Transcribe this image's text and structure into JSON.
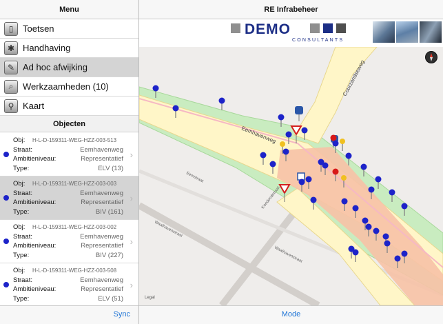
{
  "sidebar": {
    "title": "Menu",
    "menu": [
      {
        "label": "Toetsen",
        "icon": "document-icon"
      },
      {
        "label": "Handhaving",
        "icon": "sparkle-icon"
      },
      {
        "label": "Ad hoc afwijking",
        "icon": "pencil-icon",
        "selected": true
      },
      {
        "label": "Werkzaamheden (10)",
        "icon": "magnifier-icon"
      },
      {
        "label": "Kaart",
        "icon": "map-pin-icon"
      }
    ],
    "section_title": "Objecten",
    "field_labels": {
      "obj": "Obj:",
      "straat": "Straat:",
      "ambitie": "Ambitieniveau:",
      "type": "Type:"
    },
    "objects": [
      {
        "obj": "H-L-D-159311-WEG-HZZ-003-513",
        "straat": "Eemhavenweg",
        "ambitie": "Representatief",
        "type": "ELV (13)"
      },
      {
        "obj": "H-L-D-159311-WEG-HZZ-003-003",
        "straat": "Eemhavenweg",
        "ambitie": "Representatief",
        "type": "BIV (161)",
        "selected": true
      },
      {
        "obj": "H-L-D-159311-WEG-HZZ-003-002",
        "straat": "Eemhavenweg",
        "ambitie": "Representatief",
        "type": "BIV (227)"
      },
      {
        "obj": "H-L-D-159311-WEG-HZZ-003-508",
        "straat": "Eemhavenweg",
        "ambitie": "Representatief",
        "type": "ELV (51)"
      }
    ],
    "sync_label": "Sync"
  },
  "main": {
    "title": "RE Infrabeheer",
    "logo_text": "DEMO",
    "logo_sub": "CONSULTANTS",
    "mode_label": "Mode"
  },
  "map": {
    "streets": [
      "Courzandseweg",
      "Eemhavenweg",
      "Eemstraat",
      "Koedoodstraat",
      "Waalhavenstraat",
      "Waalhavenstraat"
    ],
    "legal": "Legal",
    "colors": {
      "road": "#fff6c8",
      "verge": "#c9ecc0",
      "highlight": "#f7c2a6",
      "pin_blue": "#1d23c9",
      "pin_red": "#d81818",
      "pin_yellow": "#f0c020",
      "brand": "#1c2e86",
      "link": "#1e74d6"
    }
  }
}
